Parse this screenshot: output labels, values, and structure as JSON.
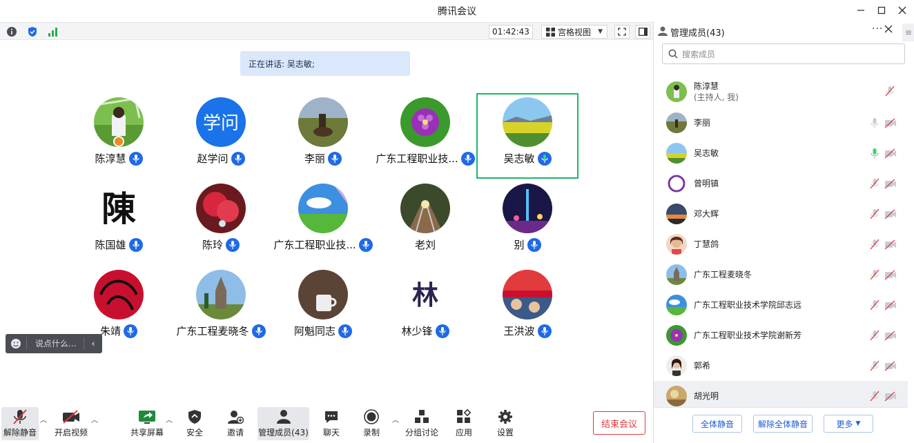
{
  "window": {
    "title": "腾讯会议"
  },
  "toolbar": {
    "timer": "01:42:43",
    "view_label": "宫格视图"
  },
  "speaking": {
    "text": "正在讲话: 吴志敏;"
  },
  "grid": [
    {
      "name": "陈淳慧",
      "avatar": "meadow-child",
      "mic": "on"
    },
    {
      "name": "赵学问",
      "avatar": "text-学问",
      "mic": "on"
    },
    {
      "name": "李丽",
      "avatar": "horse-rider",
      "mic": "on"
    },
    {
      "name": "广东工程职业技...",
      "avatar": "purple-flower",
      "mic": "on"
    },
    {
      "name": "吴志敏",
      "avatar": "field-landscape",
      "mic": "speaking"
    },
    {
      "name": "陈国雄",
      "avatar": "text-陳",
      "mic": "on"
    },
    {
      "name": "陈玲",
      "avatar": "red-flower",
      "mic": "on"
    },
    {
      "name": "广东工程职业技...",
      "avatar": "sky-field",
      "mic": "on"
    },
    {
      "name": "老刘",
      "avatar": "railway",
      "mic": "none"
    },
    {
      "name": "别",
      "avatar": "city-tower",
      "mic": "on"
    },
    {
      "name": "朱靖",
      "avatar": "red-calligraphy",
      "mic": "on"
    },
    {
      "name": "广东工程麦晓冬",
      "avatar": "church",
      "mic": "on"
    },
    {
      "name": "阿魁同志",
      "avatar": "cup",
      "mic": "on"
    },
    {
      "name": "林少锋",
      "avatar": "text-林",
      "mic": "on"
    },
    {
      "name": "王洪波",
      "avatar": "red-banner",
      "mic": "on"
    }
  ],
  "chat": {
    "placeholder": "说点什么..."
  },
  "bottom": {
    "unmute": "解除静音",
    "video": "开启视频",
    "share": "共享屏幕",
    "security": "安全",
    "invite": "邀请",
    "members": "管理成员(43)",
    "chat": "聊天",
    "record": "录制",
    "breakout": "分组讨论",
    "apps": "应用",
    "settings": "设置",
    "end": "结束会议"
  },
  "panel": {
    "title": "管理成员(43)",
    "search_placeholder": "搜索成员",
    "members": [
      {
        "name": "陈淳慧",
        "sub": "(主持人, 我)",
        "avatar": "meadow-child",
        "mic": "muted",
        "cam": "none"
      },
      {
        "name": "李丽",
        "sub": "",
        "avatar": "horse-rider",
        "mic": "idle",
        "cam": "off"
      },
      {
        "name": "吴志敏",
        "sub": "",
        "avatar": "field-landscape",
        "mic": "speaking",
        "cam": "off"
      },
      {
        "name": "曾明镇",
        "sub": "",
        "avatar": "purple-ring",
        "mic": "muted",
        "cam": "off"
      },
      {
        "name": "邓大辉",
        "sub": "",
        "avatar": "sunset",
        "mic": "muted",
        "cam": "off"
      },
      {
        "name": "丁慧鸽",
        "sub": "",
        "avatar": "portrait",
        "mic": "muted",
        "cam": "off"
      },
      {
        "name": "广东工程麦晓冬",
        "sub": "",
        "avatar": "church",
        "mic": "muted",
        "cam": "off"
      },
      {
        "name": "广东工程职业技术学院邱志远",
        "sub": "",
        "avatar": "sky-field",
        "mic": "muted",
        "cam": "off"
      },
      {
        "name": "广东工程职业技术学院谢新芳",
        "sub": "",
        "avatar": "purple-flower",
        "mic": "muted",
        "cam": "off"
      },
      {
        "name": "郭希",
        "sub": "",
        "avatar": "portrait2",
        "mic": "muted",
        "cam": "off"
      },
      {
        "name": "胡光明",
        "sub": "",
        "avatar": "desert",
        "mic": "muted",
        "cam": "off"
      }
    ],
    "mute_all": "全体静音",
    "unmute_all": "解除全体静音",
    "more": "更多"
  },
  "colors": {
    "accent": "#1f6ae6",
    "active_border": "#1db56a",
    "end_red": "#e0383e"
  }
}
